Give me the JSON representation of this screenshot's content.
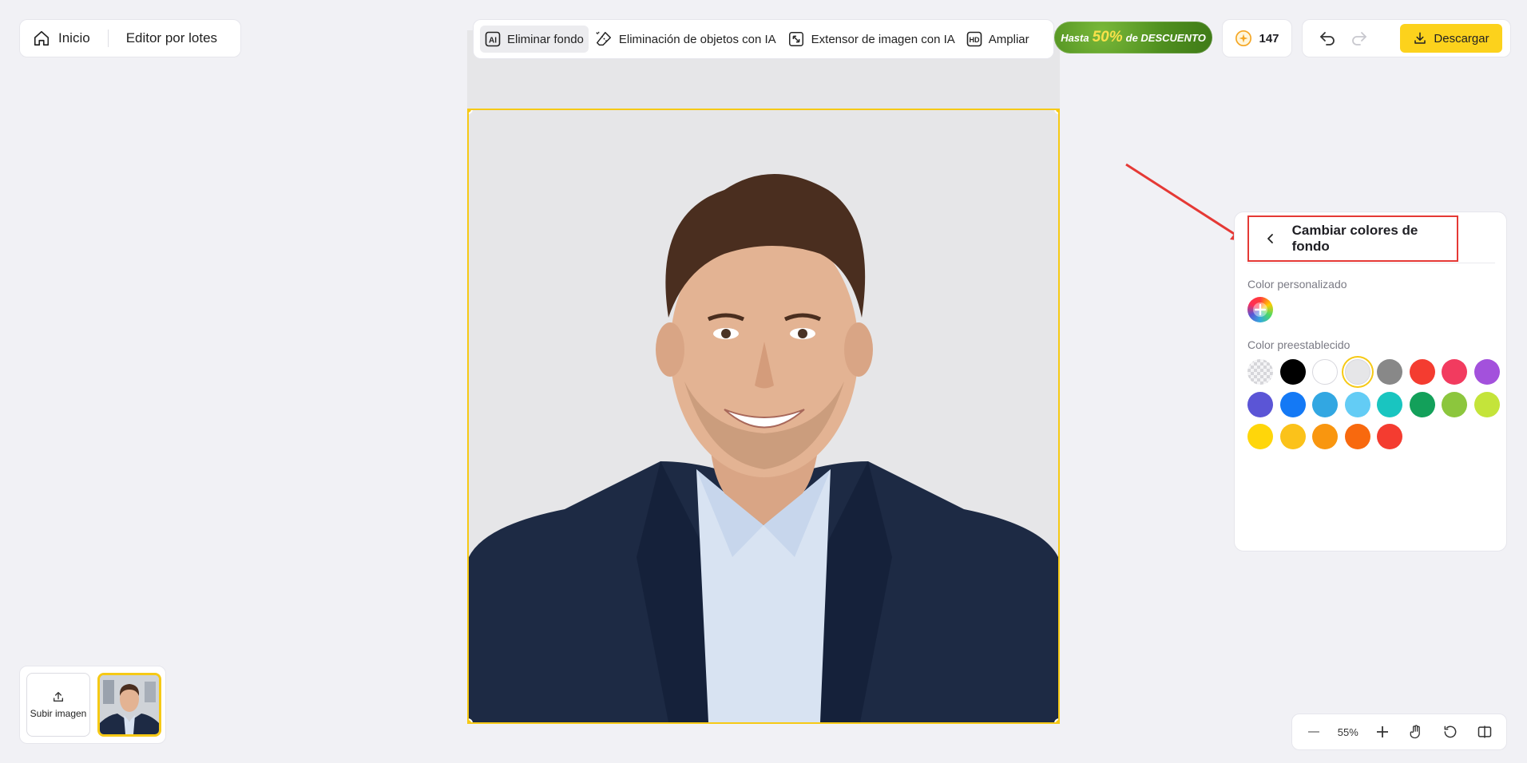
{
  "nav": {
    "home_label": "Inicio",
    "batch_label": "Editor por lotes"
  },
  "tools": [
    {
      "label": "Eliminar fondo",
      "icon": "ai-icon",
      "active": true
    },
    {
      "label": "Eliminación de objetos con IA",
      "icon": "eraser-icon"
    },
    {
      "label": "Extensor de imagen con IA",
      "icon": "expand-icon"
    },
    {
      "label": "Ampliar",
      "icon": "hd-icon"
    }
  ],
  "promo": {
    "prefix": "Hasta",
    "percent": "50%",
    "suffix": "de DESCUENTO"
  },
  "credits": {
    "count": "147",
    "icon": "star-coin-icon"
  },
  "actions": {
    "download_label": "Descargar"
  },
  "panel": {
    "title": "Cambiar colores de fondo",
    "custom_label": "Color personalizado",
    "preset_label": "Color preestablecido",
    "selected_index": 3,
    "preset_colors": [
      "transparent",
      "#000000",
      "#ffffff",
      "#e6e6e8",
      "#888888",
      "#f43c30",
      "#f23b5f",
      "#a351dc",
      "#5b55d6",
      "#1479f5",
      "#32a7e2",
      "#63ccf5",
      "#19c5c0",
      "#13a05a",
      "#8cc63d",
      "#c4e43a",
      "#ffd60a",
      "#fbc21a",
      "#f9960f",
      "#f8690e",
      "#f43c30"
    ]
  },
  "thumbs": {
    "upload_label": "Subir imagen"
  },
  "zoom": {
    "value": "55%"
  },
  "colors": {
    "accent": "#f6c915",
    "highlight": "#e53935",
    "canvas_bg": "#e6e6e8"
  }
}
